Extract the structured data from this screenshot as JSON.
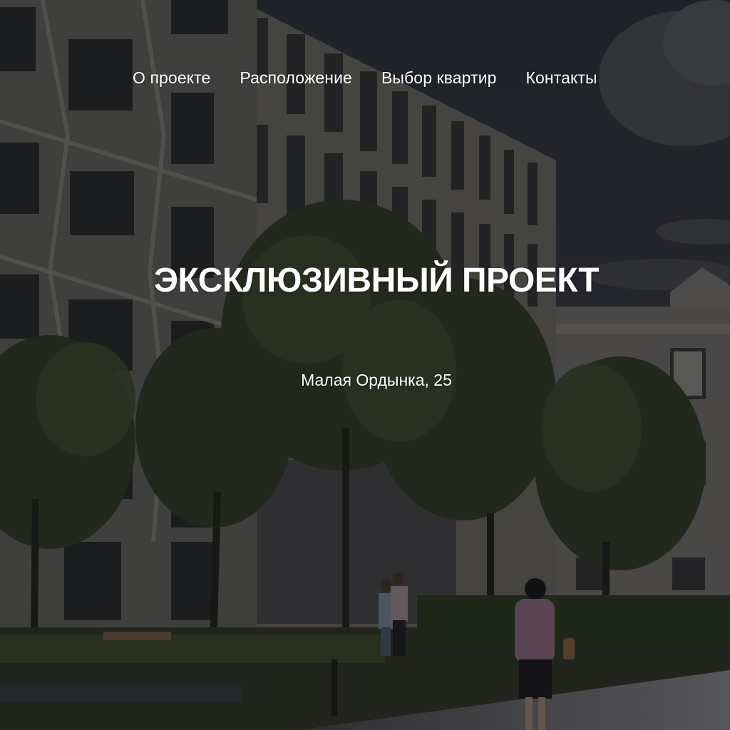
{
  "nav": {
    "items": [
      {
        "label": "О проекте"
      },
      {
        "label": "Расположение"
      },
      {
        "label": "Выбор квартир"
      },
      {
        "label": "Контакты"
      }
    ]
  },
  "hero": {
    "title": "ЭКСКЛЮЗИВНЫЙ ПРОЕКТ",
    "address": "Малая Ордынка, 25"
  },
  "colors": {
    "text": "#ffffff",
    "sky": "#2b2e35",
    "facade": "#5b5a58",
    "foliage": "#2b3222",
    "pavement": "#55555a"
  }
}
